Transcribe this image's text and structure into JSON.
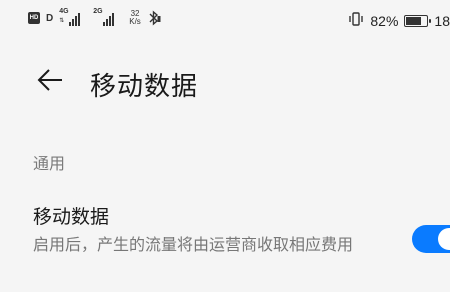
{
  "status_bar": {
    "hd_label": "HD",
    "hd_suffix": "D",
    "sim1_tech": "4G",
    "sim2_tech": "2G",
    "speed_value": "32",
    "speed_unit": "K/s",
    "battery_percent": "82%",
    "battery_level": 0.82,
    "clock": "18"
  },
  "header": {
    "title": "移动数据"
  },
  "section": {
    "label": "通用"
  },
  "setting": {
    "title": "移动数据",
    "description": "启用后，产生的流量将由运营商收取相应费用",
    "enabled": true
  },
  "colors": {
    "accent": "#0a7bff",
    "background": "#f5f5f5"
  }
}
